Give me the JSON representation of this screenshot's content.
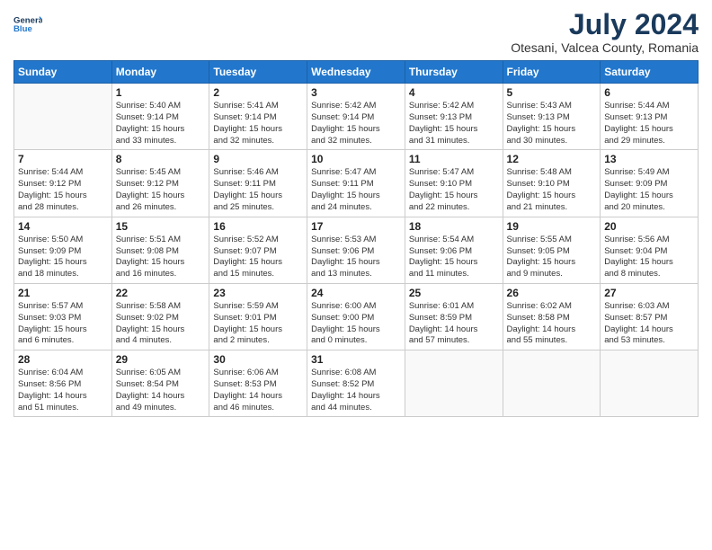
{
  "logo": {
    "line1": "General",
    "line2": "Blue"
  },
  "title": "July 2024",
  "subtitle": "Otesani, Valcea County, Romania",
  "weekdays": [
    "Sunday",
    "Monday",
    "Tuesday",
    "Wednesday",
    "Thursday",
    "Friday",
    "Saturday"
  ],
  "weeks": [
    [
      {
        "day": "",
        "info": ""
      },
      {
        "day": "1",
        "info": "Sunrise: 5:40 AM\nSunset: 9:14 PM\nDaylight: 15 hours\nand 33 minutes."
      },
      {
        "day": "2",
        "info": "Sunrise: 5:41 AM\nSunset: 9:14 PM\nDaylight: 15 hours\nand 32 minutes."
      },
      {
        "day": "3",
        "info": "Sunrise: 5:42 AM\nSunset: 9:14 PM\nDaylight: 15 hours\nand 32 minutes."
      },
      {
        "day": "4",
        "info": "Sunrise: 5:42 AM\nSunset: 9:13 PM\nDaylight: 15 hours\nand 31 minutes."
      },
      {
        "day": "5",
        "info": "Sunrise: 5:43 AM\nSunset: 9:13 PM\nDaylight: 15 hours\nand 30 minutes."
      },
      {
        "day": "6",
        "info": "Sunrise: 5:44 AM\nSunset: 9:13 PM\nDaylight: 15 hours\nand 29 minutes."
      }
    ],
    [
      {
        "day": "7",
        "info": "Sunrise: 5:44 AM\nSunset: 9:12 PM\nDaylight: 15 hours\nand 28 minutes."
      },
      {
        "day": "8",
        "info": "Sunrise: 5:45 AM\nSunset: 9:12 PM\nDaylight: 15 hours\nand 26 minutes."
      },
      {
        "day": "9",
        "info": "Sunrise: 5:46 AM\nSunset: 9:11 PM\nDaylight: 15 hours\nand 25 minutes."
      },
      {
        "day": "10",
        "info": "Sunrise: 5:47 AM\nSunset: 9:11 PM\nDaylight: 15 hours\nand 24 minutes."
      },
      {
        "day": "11",
        "info": "Sunrise: 5:47 AM\nSunset: 9:10 PM\nDaylight: 15 hours\nand 22 minutes."
      },
      {
        "day": "12",
        "info": "Sunrise: 5:48 AM\nSunset: 9:10 PM\nDaylight: 15 hours\nand 21 minutes."
      },
      {
        "day": "13",
        "info": "Sunrise: 5:49 AM\nSunset: 9:09 PM\nDaylight: 15 hours\nand 20 minutes."
      }
    ],
    [
      {
        "day": "14",
        "info": "Sunrise: 5:50 AM\nSunset: 9:09 PM\nDaylight: 15 hours\nand 18 minutes."
      },
      {
        "day": "15",
        "info": "Sunrise: 5:51 AM\nSunset: 9:08 PM\nDaylight: 15 hours\nand 16 minutes."
      },
      {
        "day": "16",
        "info": "Sunrise: 5:52 AM\nSunset: 9:07 PM\nDaylight: 15 hours\nand 15 minutes."
      },
      {
        "day": "17",
        "info": "Sunrise: 5:53 AM\nSunset: 9:06 PM\nDaylight: 15 hours\nand 13 minutes."
      },
      {
        "day": "18",
        "info": "Sunrise: 5:54 AM\nSunset: 9:06 PM\nDaylight: 15 hours\nand 11 minutes."
      },
      {
        "day": "19",
        "info": "Sunrise: 5:55 AM\nSunset: 9:05 PM\nDaylight: 15 hours\nand 9 minutes."
      },
      {
        "day": "20",
        "info": "Sunrise: 5:56 AM\nSunset: 9:04 PM\nDaylight: 15 hours\nand 8 minutes."
      }
    ],
    [
      {
        "day": "21",
        "info": "Sunrise: 5:57 AM\nSunset: 9:03 PM\nDaylight: 15 hours\nand 6 minutes."
      },
      {
        "day": "22",
        "info": "Sunrise: 5:58 AM\nSunset: 9:02 PM\nDaylight: 15 hours\nand 4 minutes."
      },
      {
        "day": "23",
        "info": "Sunrise: 5:59 AM\nSunset: 9:01 PM\nDaylight: 15 hours\nand 2 minutes."
      },
      {
        "day": "24",
        "info": "Sunrise: 6:00 AM\nSunset: 9:00 PM\nDaylight: 15 hours\nand 0 minutes."
      },
      {
        "day": "25",
        "info": "Sunrise: 6:01 AM\nSunset: 8:59 PM\nDaylight: 14 hours\nand 57 minutes."
      },
      {
        "day": "26",
        "info": "Sunrise: 6:02 AM\nSunset: 8:58 PM\nDaylight: 14 hours\nand 55 minutes."
      },
      {
        "day": "27",
        "info": "Sunrise: 6:03 AM\nSunset: 8:57 PM\nDaylight: 14 hours\nand 53 minutes."
      }
    ],
    [
      {
        "day": "28",
        "info": "Sunrise: 6:04 AM\nSunset: 8:56 PM\nDaylight: 14 hours\nand 51 minutes."
      },
      {
        "day": "29",
        "info": "Sunrise: 6:05 AM\nSunset: 8:54 PM\nDaylight: 14 hours\nand 49 minutes."
      },
      {
        "day": "30",
        "info": "Sunrise: 6:06 AM\nSunset: 8:53 PM\nDaylight: 14 hours\nand 46 minutes."
      },
      {
        "day": "31",
        "info": "Sunrise: 6:08 AM\nSunset: 8:52 PM\nDaylight: 14 hours\nand 44 minutes."
      },
      {
        "day": "",
        "info": ""
      },
      {
        "day": "",
        "info": ""
      },
      {
        "day": "",
        "info": ""
      }
    ]
  ]
}
